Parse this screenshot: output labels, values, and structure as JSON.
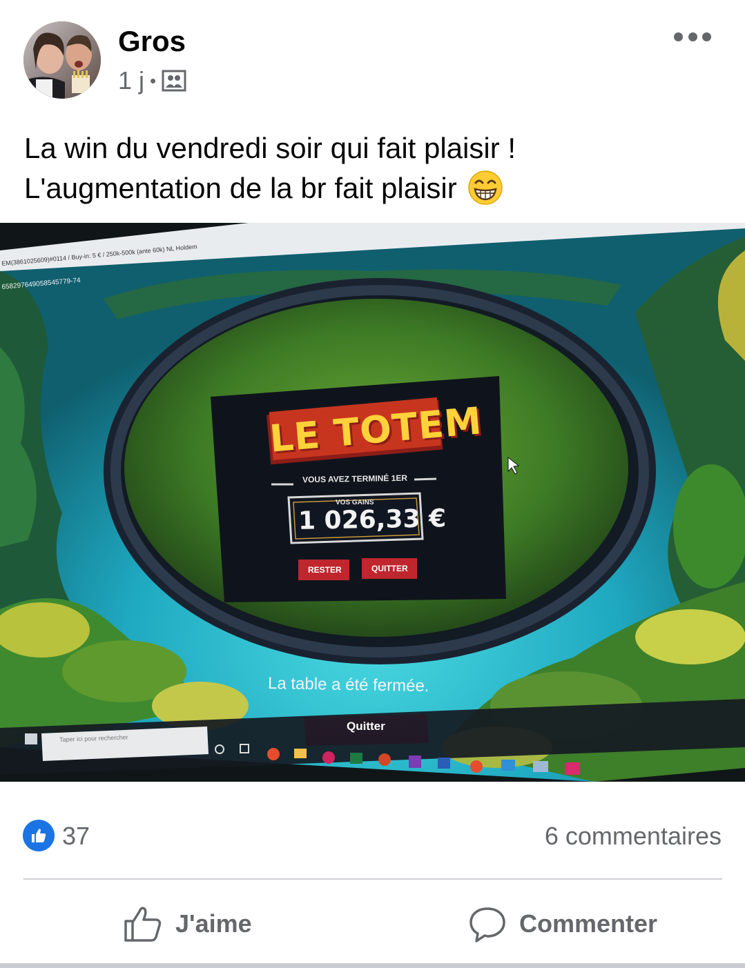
{
  "post": {
    "author": "Gros",
    "time": "1 j",
    "separator": "•",
    "privacy_icon": "photo-album-icon",
    "caption_line1": "La win du vendredi soir qui fait plaisir !",
    "caption_line2": "L'augmentation de la br fait plaisir",
    "caption_emoji": "grinning-face-emoji"
  },
  "photo": {
    "window_title": "EM(3861025609)#0114 / Buy-in: 5 € / 250k-500k (ante 60k) NL Holdem",
    "table_id": "658297649058545779-74",
    "logo": "LE TOTEM",
    "finished_text": "VOUS AVEZ TERMINÉ 1ER",
    "winnings_label": "VOS GAINS",
    "winnings_value": "1 026,33 €",
    "stay_button": "RESTER",
    "quit_button": "QUITTER",
    "table_closed": "La table a été fermée.",
    "bottom_quit_button": "Quitter",
    "taskbar_search": "Taper ici pour rechercher"
  },
  "stats": {
    "likes": "37",
    "comments": "6 commentaires"
  },
  "actions": {
    "like": "J'aime",
    "comment": "Commenter"
  },
  "colors": {
    "facebook_blue": "#1b74e4",
    "secondary_text": "#65676b",
    "divider": "#ced0d4",
    "button_red": "#c0262d",
    "quit_pink": "#c2185b"
  }
}
